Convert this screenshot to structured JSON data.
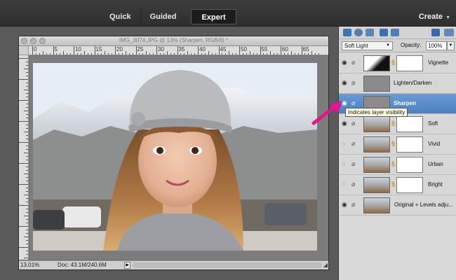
{
  "topbar": {
    "modes": [
      {
        "label": "Quick",
        "active": false
      },
      {
        "label": "Guided",
        "active": false
      },
      {
        "label": "Expert",
        "active": true
      }
    ],
    "create_label": "Create"
  },
  "document": {
    "title": "IMG_3074.JPG @ 13% (Sharpen, RGB/8) *",
    "ruler_numbers": [
      "0",
      "5",
      "10",
      "15",
      "20",
      "25",
      "30",
      "35",
      "40",
      "45",
      "50",
      "55",
      "60",
      "65"
    ],
    "zoom": "13.01%",
    "doc_size": "Doc: 43.1M/240.6M"
  },
  "layers_panel": {
    "blend_mode": "Soft Light",
    "opacity_label": "Opacity:",
    "opacity_value": "100%",
    "layers": [
      {
        "name": "Vignette",
        "thumb": "adj",
        "mask": true,
        "visible": true,
        "selected": false
      },
      {
        "name": "Lighten/Darken",
        "thumb": "gray",
        "mask": false,
        "visible": true,
        "selected": false
      },
      {
        "name": "Sharpen",
        "thumb": "gray",
        "mask": false,
        "visible": true,
        "selected": true
      },
      {
        "name": "Soft",
        "thumb": "photo",
        "mask": true,
        "visible": true,
        "selected": false
      },
      {
        "name": "Vivid",
        "thumb": "photo",
        "mask": true,
        "visible": false,
        "selected": false
      },
      {
        "name": "Urban",
        "thumb": "photo",
        "mask": true,
        "visible": false,
        "selected": false
      },
      {
        "name": "Bright",
        "thumb": "photo",
        "mask": true,
        "visible": false,
        "selected": false
      },
      {
        "name": "Original + Levels adju...",
        "thumb": "photo",
        "mask": false,
        "visible": true,
        "selected": false
      }
    ]
  },
  "tooltip": "Indicates layer visibility",
  "colors": {
    "selected_layer": "#4d80c0",
    "annotation_arrow": "#e0158f"
  }
}
